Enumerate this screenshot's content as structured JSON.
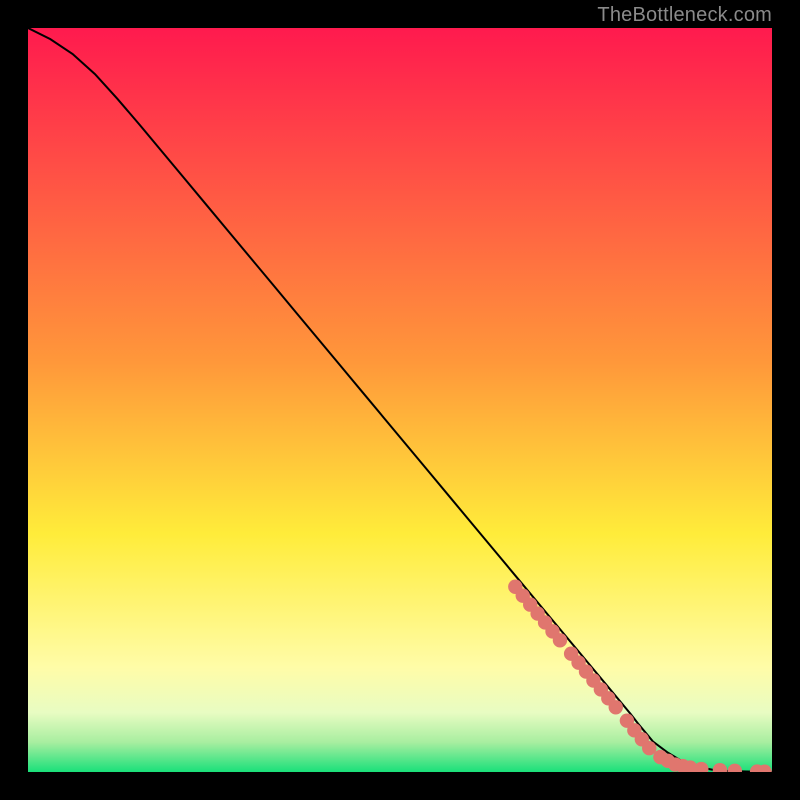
{
  "attribution": "TheBottleneck.com",
  "colors": {
    "gradient_top": "#ff1a4e",
    "gradient_mid": "#ffec3a",
    "gradient_band": "#f8ffd6",
    "gradient_band2": "#d3f9b5",
    "gradient_bottom": "#1ae07a",
    "line": "#000000",
    "marker": "#e0766e",
    "background": "#000000"
  },
  "chart_data": {
    "type": "line",
    "title": "",
    "xlabel": "",
    "ylabel": "",
    "xlim": [
      0,
      100
    ],
    "ylim": [
      0,
      100
    ],
    "series": [
      {
        "name": "curve",
        "x": [
          0,
          3,
          6,
          9,
          12,
          15,
          18,
          21,
          24,
          27,
          30,
          33,
          36,
          39,
          42,
          45,
          48,
          51,
          54,
          57,
          60,
          63,
          66,
          69,
          72,
          75,
          78,
          81,
          82,
          83,
          84,
          86,
          88,
          90,
          92,
          94,
          96,
          98,
          100
        ],
        "y": [
          100,
          98.5,
          96.5,
          93.8,
          90.5,
          87.0,
          83.4,
          79.8,
          76.2,
          72.6,
          69.0,
          65.4,
          61.8,
          58.2,
          54.6,
          51.0,
          47.4,
          43.8,
          40.2,
          36.6,
          33.0,
          29.4,
          25.8,
          22.2,
          18.6,
          15.0,
          11.4,
          7.8,
          6.5,
          5.3,
          4.1,
          2.6,
          1.4,
          0.7,
          0.3,
          0.15,
          0.08,
          0.04,
          0.02
        ]
      }
    ],
    "markers": [
      {
        "x": 65.5,
        "y": 24.9
      },
      {
        "x": 66.5,
        "y": 23.7
      },
      {
        "x": 67.5,
        "y": 22.5
      },
      {
        "x": 68.5,
        "y": 21.3
      },
      {
        "x": 69.5,
        "y": 20.1
      },
      {
        "x": 70.5,
        "y": 18.9
      },
      {
        "x": 71.5,
        "y": 17.7
      },
      {
        "x": 73.0,
        "y": 15.9
      },
      {
        "x": 74.0,
        "y": 14.7
      },
      {
        "x": 75.0,
        "y": 13.5
      },
      {
        "x": 76.0,
        "y": 12.3
      },
      {
        "x": 77.0,
        "y": 11.1
      },
      {
        "x": 78.0,
        "y": 9.9
      },
      {
        "x": 79.0,
        "y": 8.7
      },
      {
        "x": 80.5,
        "y": 6.9
      },
      {
        "x": 81.5,
        "y": 5.6
      },
      {
        "x": 82.5,
        "y": 4.4
      },
      {
        "x": 83.5,
        "y": 3.2
      },
      {
        "x": 85.0,
        "y": 2.0
      },
      {
        "x": 86.0,
        "y": 1.5
      },
      {
        "x": 87.0,
        "y": 1.0
      },
      {
        "x": 88.0,
        "y": 0.8
      },
      {
        "x": 89.0,
        "y": 0.6
      },
      {
        "x": 90.5,
        "y": 0.4
      },
      {
        "x": 93.0,
        "y": 0.25
      },
      {
        "x": 95.0,
        "y": 0.15
      },
      {
        "x": 98.0,
        "y": 0.06
      },
      {
        "x": 99.0,
        "y": 0.04
      }
    ]
  }
}
